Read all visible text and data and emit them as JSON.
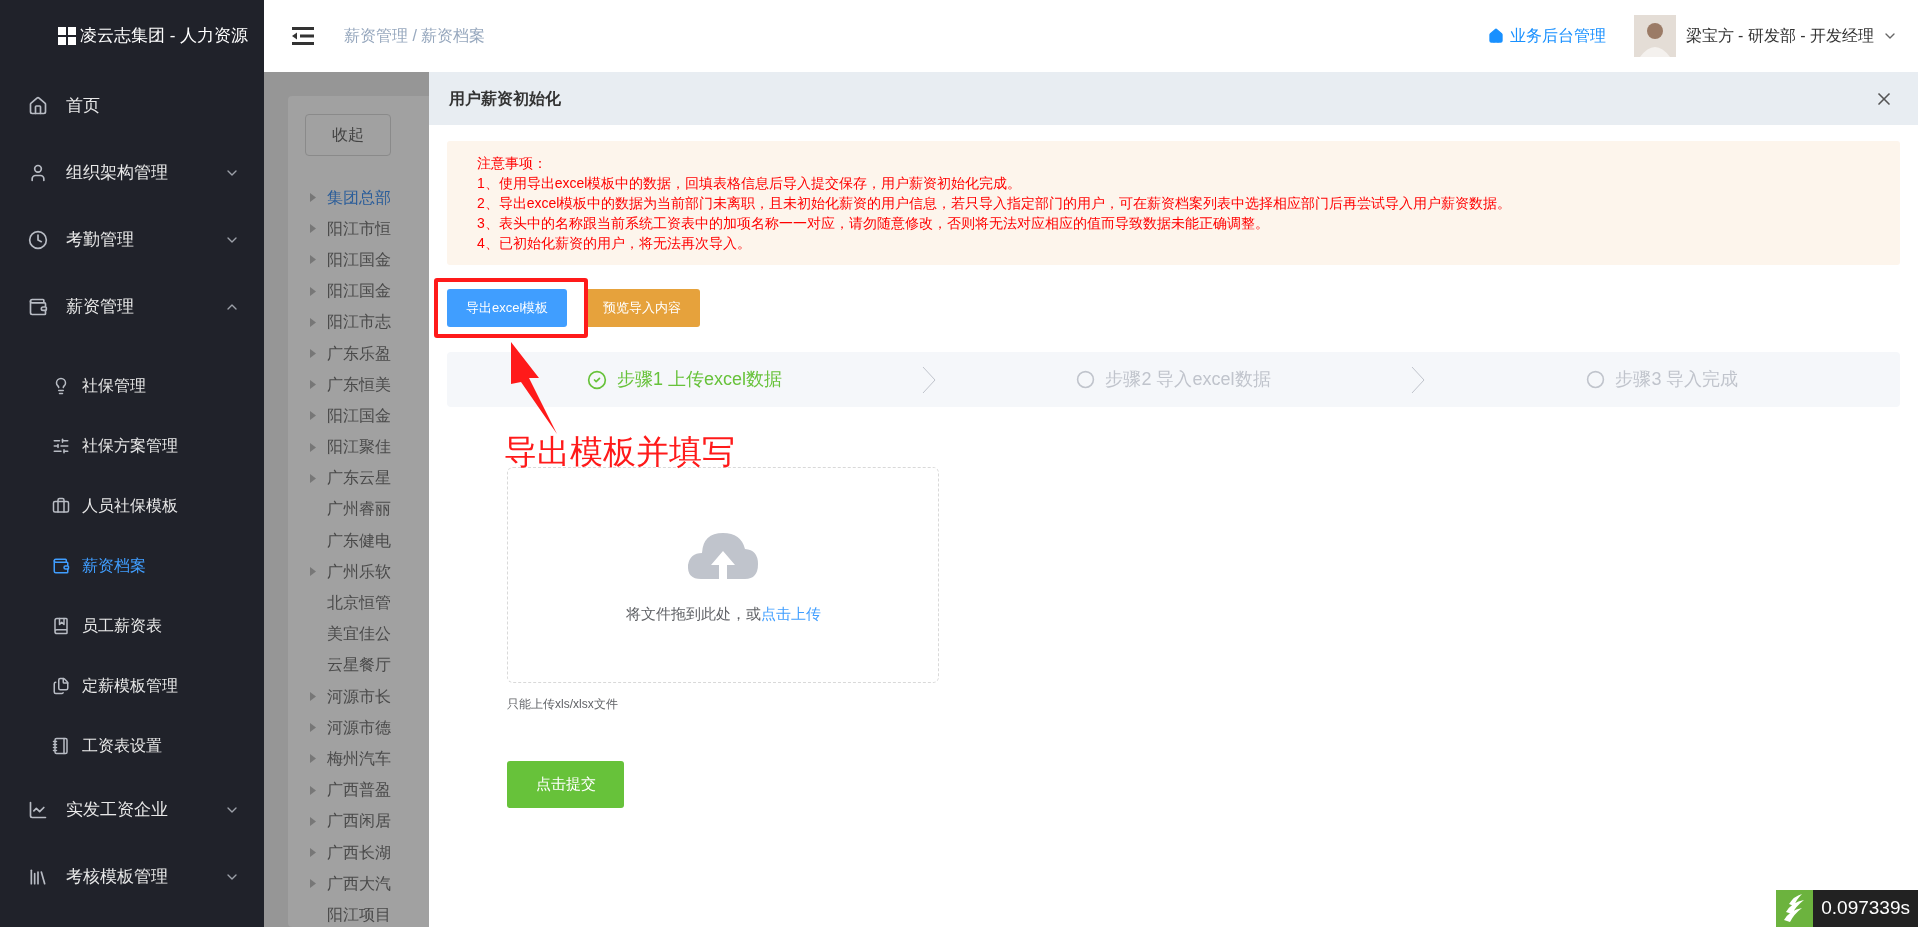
{
  "sidebar": {
    "logo": "凌云志集团 - 人力资源",
    "items": [
      {
        "label": "首页",
        "selected": false
      },
      {
        "label": "组织架构管理",
        "selected": false,
        "expanded": false
      },
      {
        "label": "考勤管理",
        "selected": false,
        "expanded": false
      },
      {
        "label": "薪资管理",
        "selected": false,
        "expanded": true,
        "children": [
          {
            "label": "社保管理",
            "selected": false
          },
          {
            "label": "社保方案管理",
            "selected": false
          },
          {
            "label": "人员社保模板",
            "selected": false
          },
          {
            "label": "薪资档案",
            "selected": true
          },
          {
            "label": "员工薪资表",
            "selected": false
          },
          {
            "label": "定薪模板管理",
            "selected": false
          },
          {
            "label": "工资表设置",
            "selected": false
          }
        ]
      },
      {
        "label": "实发工资企业",
        "selected": false,
        "expanded": false
      },
      {
        "label": "考核模板管理",
        "selected": false,
        "expanded": false
      }
    ]
  },
  "header": {
    "breadcrumb": "薪资管理 / 薪资档案",
    "backend_link": "业务后台管理",
    "user": "梁宝方 - 研发部 - 开发经理"
  },
  "tree_panel": {
    "collapse_button": "收起",
    "nodes": [
      {
        "label": "集团总部",
        "selected": true,
        "has_children": true
      },
      {
        "label": "阳江市恒",
        "selected": false,
        "has_children": true
      },
      {
        "label": "阳江国金",
        "selected": false,
        "has_children": true
      },
      {
        "label": "阳江国金",
        "selected": false,
        "has_children": true
      },
      {
        "label": "阳江市志",
        "selected": false,
        "has_children": true
      },
      {
        "label": "广东乐盈",
        "selected": false,
        "has_children": true
      },
      {
        "label": "广东恒美",
        "selected": false,
        "has_children": true
      },
      {
        "label": "阳江国金",
        "selected": false,
        "has_children": true
      },
      {
        "label": "阳江聚佳",
        "selected": false,
        "has_children": true
      },
      {
        "label": "广东云星",
        "selected": false,
        "has_children": true
      },
      {
        "label": "广州睿丽",
        "selected": false,
        "has_children": false
      },
      {
        "label": "广东健电",
        "selected": false,
        "has_children": false
      },
      {
        "label": "广州乐软",
        "selected": false,
        "has_children": true
      },
      {
        "label": "北京恒管",
        "selected": false,
        "has_children": false
      },
      {
        "label": "美宜佳公",
        "selected": false,
        "has_children": false
      },
      {
        "label": "云星餐厅",
        "selected": false,
        "has_children": false
      },
      {
        "label": "河源市长",
        "selected": false,
        "has_children": true
      },
      {
        "label": "河源市德",
        "selected": false,
        "has_children": true
      },
      {
        "label": "梅州汽车",
        "selected": false,
        "has_children": true
      },
      {
        "label": "广西普盈",
        "selected": false,
        "has_children": true
      },
      {
        "label": "广西闲居",
        "selected": false,
        "has_children": true
      },
      {
        "label": "广西长湖",
        "selected": false,
        "has_children": true
      },
      {
        "label": "广西大汽",
        "selected": false,
        "has_children": true
      },
      {
        "label": "阳江项目",
        "selected": false,
        "has_children": false
      }
    ]
  },
  "dialog": {
    "title": "用户薪资初始化",
    "notice": [
      "注意事项：",
      "1、使用导出excel模板中的数据，回填表格信息后导入提交保存，用户薪资初始化完成。",
      "2、导出excel模板中的数据为当前部门未离职，且未初始化薪资的用户信息，若只导入指定部门的用户，可在薪资档案列表中选择相应部门后再尝试导入用户薪资数据。",
      "3、表头中的名称跟当前系统工资表中的加项名称一一对应，请勿随意修改，否则将无法对应相应的值而导致数据未能正确调整。",
      "4、已初始化薪资的用户，将无法再次导入。"
    ],
    "buttons": [
      {
        "label": "导出excel模板",
        "kind": "primary"
      },
      {
        "label": "预览导入内容",
        "kind": "warning"
      }
    ],
    "steps": [
      {
        "label": "步骤1 上传excel数据",
        "completed": true
      },
      {
        "label": "步骤2 导入excel数据",
        "completed": false
      },
      {
        "label": "步骤3 导入完成",
        "completed": false
      }
    ],
    "upload": {
      "text": "将文件拖到此处，或",
      "link": "点击上传",
      "tip": "只能上传xls/xlsx文件"
    },
    "submit": "点击提交"
  },
  "annotation": {
    "text": "导出模板并填写"
  },
  "timer": "0.097339s"
}
